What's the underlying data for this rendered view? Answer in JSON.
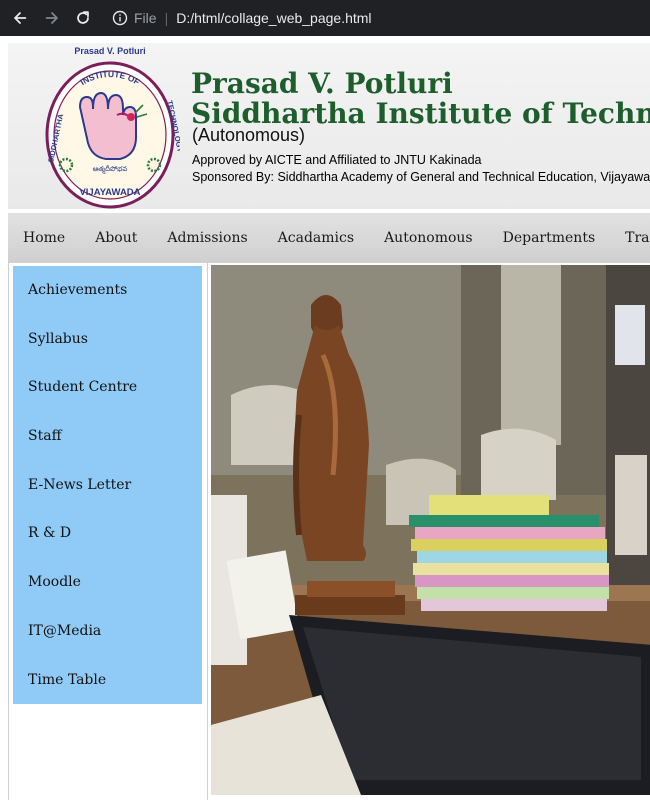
{
  "browser": {
    "scheme_label": "File",
    "url": "D:/html/collage_web_page.html"
  },
  "logo": {
    "top_text": "Prasad V. Potluri",
    "ring_left": "SIDDHARTHA",
    "ring_top": "INSTITUTE OF",
    "ring_right": "TECHNOLOGY",
    "bottom_text": "VIJAYAWADA",
    "motto": "ఆత్మదీపోభవ"
  },
  "header": {
    "title_line1": "Prasad V. Potluri",
    "title_line2": "Siddhartha Institute of Technology",
    "autonomous": "(Autonomous)",
    "approved": "Approved by AICTE and Affiliated to JNTU Kakinada",
    "sponsored": "Sponsored By: Siddhartha Academy of General and Technical Education, Vijayawada"
  },
  "menu": {
    "items": [
      "Home",
      "About",
      "Admissions",
      "Acadamics",
      "Autonomous",
      "Departments",
      "Training & Placements"
    ]
  },
  "sidebar": {
    "items": [
      "Achievements",
      "Syllabus",
      "Student Centre",
      "Staff",
      "E-News Letter",
      "R & D",
      "Moodle",
      "IT@Media",
      "Time Table"
    ]
  },
  "colors": {
    "title_green": "#1d5e2c",
    "sidebar_blue": "#8fcbf6",
    "menubar_gray": "#d6d6d6"
  },
  "icons": [
    "back-arrow-icon",
    "forward-arrow-icon",
    "reload-icon",
    "info-icon"
  ]
}
